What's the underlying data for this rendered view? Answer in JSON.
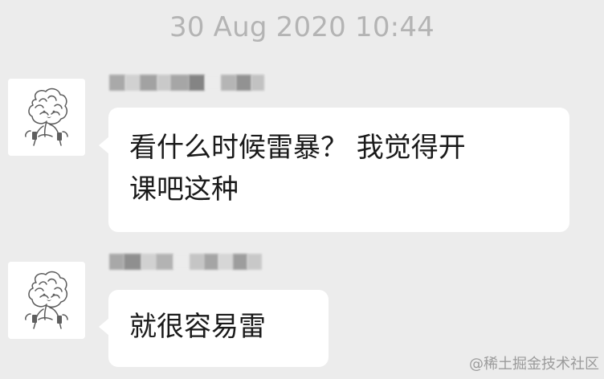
{
  "timestamp": "30 Aug 2020 10:44",
  "messages": [
    {
      "sender_name_hidden": true,
      "avatar_icon": "sketch-avatar-icon",
      "text": "看什么时候雷暴？ 我觉得开\n课吧这种"
    },
    {
      "sender_name_hidden": true,
      "avatar_icon": "sketch-avatar-icon",
      "text": "就很容易雷"
    }
  ],
  "watermark": "@稀土掘金技术社区",
  "colors": {
    "background": "#ececec",
    "bubble": "#ffffff",
    "timestamp": "#b4b4b4",
    "text": "#1a1a1a",
    "watermark": "#8d8d8d"
  }
}
